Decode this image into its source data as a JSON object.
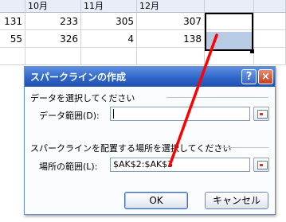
{
  "sheet": {
    "columns": [
      "10月",
      "11月",
      "12月"
    ],
    "rows": [
      [
        "131",
        "233",
        "305",
        "307"
      ],
      [
        "55",
        "326",
        "4",
        "138"
      ]
    ]
  },
  "dialog": {
    "title": "スパークラインの作成",
    "help_icon": "?",
    "close_icon": "×",
    "data_section": "データを選択してください",
    "data_range_label": "データ範囲(D):",
    "data_range_value": "",
    "location_section": "スパークラインを配置する場所を選択してください",
    "location_label": "場所の範囲(L):",
    "location_value": "$AK$2:$AK$3",
    "ok_label": "OK",
    "cancel_label": "キャンセル"
  },
  "colors": {
    "title_bar": "#2f66c9",
    "selection_fill": "#b8cbe4",
    "annotation": "#ff0000"
  },
  "icons": [
    "help-icon",
    "close-icon",
    "range-select-icon"
  ]
}
